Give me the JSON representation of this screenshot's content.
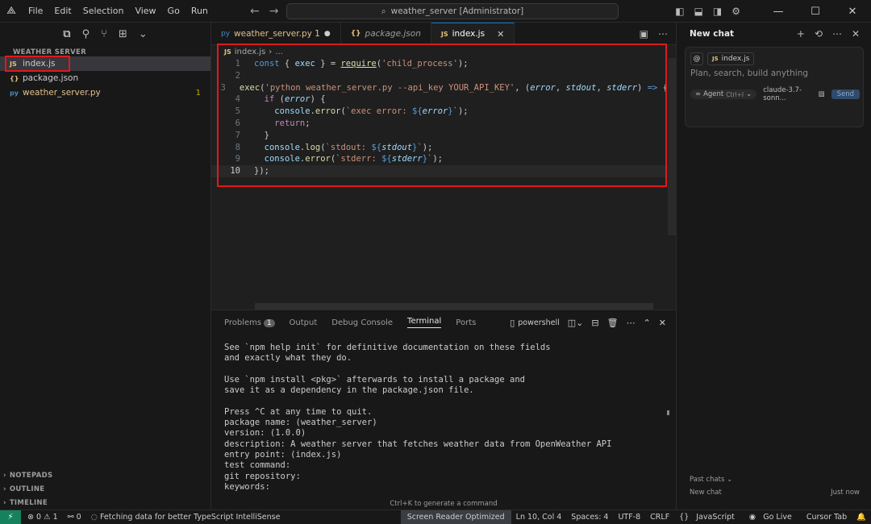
{
  "titlebar": {
    "menu": [
      "File",
      "Edit",
      "Selection",
      "View",
      "Go",
      "Run"
    ],
    "search": "weather_server [Administrator]"
  },
  "sidebar": {
    "section": "WEATHER SERVER",
    "files": [
      {
        "badge": "JS",
        "name": "index.js",
        "count": ""
      },
      {
        "badge": "{}",
        "name": "package.json",
        "count": ""
      },
      {
        "badge": "py",
        "name": "weather_server.py",
        "count": "1"
      }
    ],
    "bottom": [
      "NOTEPADS",
      "OUTLINE",
      "TIMELINE"
    ]
  },
  "tabs": [
    {
      "badge": "py",
      "label": "weather_server.py 1",
      "state": "modified"
    },
    {
      "badge": "{}",
      "label": "package.json",
      "state": "preview"
    },
    {
      "badge": "JS",
      "label": "index.js",
      "state": "active"
    }
  ],
  "breadcrumb": {
    "badge": "JS",
    "file": "index.js",
    "rest": "..."
  },
  "code": {
    "line_numbers": [
      "1",
      "2",
      "3",
      "4",
      "5",
      "6",
      "7",
      "8",
      "9",
      "10"
    ],
    "current_line": "10"
  },
  "panel": {
    "tabs": [
      "Problems",
      "Output",
      "Debug Console",
      "Terminal",
      "Ports"
    ],
    "problems_count": "1",
    "shell": "powershell",
    "terminal_lines": [
      "See `npm help init` for definitive documentation on these fields",
      "and exactly what they do.",
      "",
      "Use `npm install <pkg>` afterwards to install a package and",
      "save it as a dependency in the package.json file.",
      "",
      "Press ^C at any time to quit.",
      "package name: (weather_server)",
      "version: (1.0.0)",
      "description: A weather server that fetches weather data from OpenWeather API",
      "entry point: (index.js)",
      "test command:",
      "git repository:",
      "keywords:"
    ],
    "hint": "Ctrl+K to generate a command"
  },
  "chat": {
    "title": "New chat",
    "context_file": "index.js",
    "placeholder": "Plan, search, build anything",
    "agent_label": "Agent",
    "agent_shortcut": "Ctrl+I",
    "model": "claude-3.7-sonn...",
    "send": "Send",
    "past_chats": "Past chats",
    "past_item": "New chat",
    "past_time": "Just now"
  },
  "statusbar": {
    "errors": "0",
    "warnings": "1",
    "ports": "0",
    "message": "Fetching data for better TypeScript IntelliSense",
    "screen_reader": "Screen Reader Optimized",
    "position": "Ln 10, Col 4",
    "spaces": "Spaces: 4",
    "encoding": "UTF-8",
    "eol": "CRLF",
    "language": "JavaScript",
    "golive": "Go Live",
    "cursortab": "Cursor Tab"
  },
  "colors": {
    "highlight_box": "#e11919",
    "accent": "#0078d4",
    "remote": "#16825d"
  }
}
